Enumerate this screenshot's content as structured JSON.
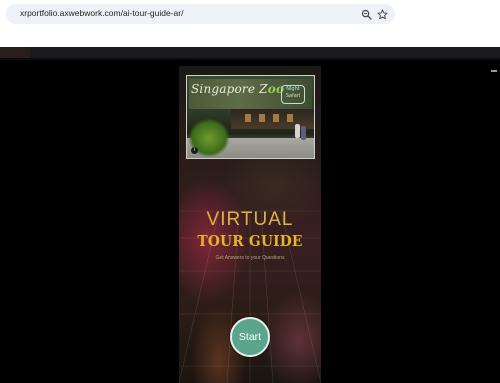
{
  "browser": {
    "url": "xrportfolio.axwebwork.com/ai-tour-guide-ar/",
    "icons": [
      "zoom-icon",
      "star-icon"
    ]
  },
  "app": {
    "photo": {
      "logo_text": "Singapore Zoo",
      "badge_text": "Night Safari"
    },
    "title_line1": "VIRTUAL",
    "title_line2": "TOUR GUIDE",
    "subtitle": "Get Answers to your Questions",
    "start_label": "Start",
    "colors": {
      "title_gold": "#e0b145",
      "start_button": "#5aa58c"
    }
  }
}
